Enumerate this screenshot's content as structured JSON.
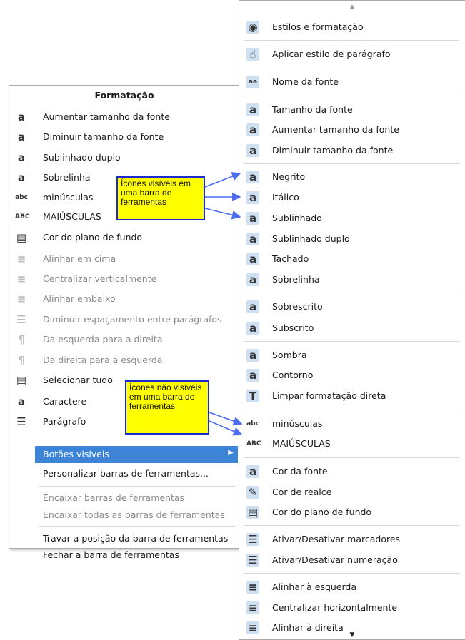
{
  "left_menu": {
    "title": "Formatação",
    "items": [
      {
        "icon": "increase-font-icon",
        "glyph": "a",
        "label": "Aumentar tamanho da fonte"
      },
      {
        "icon": "decrease-font-icon",
        "glyph": "a",
        "label": "Diminuir tamanho da fonte"
      },
      {
        "icon": "double-underline-icon",
        "glyph": "a",
        "label": "Sublinhado duplo"
      },
      {
        "icon": "overline-icon",
        "glyph": "a",
        "label": "Sobrelinha"
      },
      {
        "icon": "lowercase-icon",
        "glyph": "abc",
        "label": "minúsculas"
      },
      {
        "icon": "uppercase-icon",
        "glyph": "ABC",
        "label": "MAIÚSCULAS"
      },
      {
        "icon": "background-color-icon",
        "glyph": "▤",
        "label": "Cor do plano de fundo"
      },
      {
        "icon": "align-top-icon",
        "glyph": "≡",
        "label": "Alinhar em cima"
      },
      {
        "icon": "center-vertically-icon",
        "glyph": "≡",
        "label": "Centralizar verticalmente"
      },
      {
        "icon": "align-bottom-icon",
        "glyph": "≡",
        "label": "Alinhar embaixo"
      },
      {
        "icon": "decrease-paragraph-spacing-icon",
        "glyph": "☰",
        "label": "Diminuir espaçamento entre parágrafos"
      },
      {
        "icon": "left-to-right-icon",
        "glyph": "¶",
        "label": "Da esquerda para a direita"
      },
      {
        "icon": "right-to-left-icon",
        "glyph": "¶",
        "label": "Da direita para a esquerda"
      },
      {
        "icon": "select-all-icon",
        "glyph": "▤",
        "label": "Selecionar tudo"
      },
      {
        "icon": "character-icon",
        "glyph": "a",
        "label": "Caractere"
      },
      {
        "icon": "paragraph-icon",
        "glyph": "☰",
        "label": "Parágrafo"
      }
    ],
    "visible_buttons": "Botões visíveis",
    "customize": "Personalizar barras de ferramentas...",
    "dock": "Encaixar barras de ferramentas",
    "dock_all": "Encaixar todas as barras de ferramentas",
    "lock": "Travar a posição da barra de ferramentas",
    "close": "Fechar a barra de ferramentas"
  },
  "right_menu": {
    "items": [
      {
        "icon": "styles-icon",
        "glyph": "◉",
        "label": "Estilos e formatação"
      },
      {
        "icon": "apply-paragraph-style-icon",
        "glyph": "☝",
        "label": "Aplicar estilo de parágrafo"
      },
      {
        "icon": "font-name-icon",
        "glyph": "aa",
        "label": "Nome da fonte"
      },
      {
        "icon": "font-size-icon",
        "glyph": "a",
        "label": "Tamanho da fonte"
      },
      {
        "icon": "increase-font-icon",
        "glyph": "a",
        "label": "Aumentar tamanho da fonte"
      },
      {
        "icon": "decrease-font-icon",
        "glyph": "a",
        "label": "Diminuir tamanho da fonte"
      },
      {
        "icon": "bold-icon",
        "glyph": "a",
        "label": "Negrito"
      },
      {
        "icon": "italic-icon",
        "glyph": "a",
        "label": "Itálico"
      },
      {
        "icon": "underline-icon",
        "glyph": "a",
        "label": "Sublinhado"
      },
      {
        "icon": "double-underline-icon",
        "glyph": "a",
        "label": "Sublinhado duplo"
      },
      {
        "icon": "strikethrough-icon",
        "glyph": "a",
        "label": "Tachado"
      },
      {
        "icon": "overline-icon",
        "glyph": "a",
        "label": "Sobrelinha"
      },
      {
        "icon": "superscript-icon",
        "glyph": "a",
        "label": "Sobrescrito"
      },
      {
        "icon": "subscript-icon",
        "glyph": "a",
        "label": "Subscrito"
      },
      {
        "icon": "shadow-icon",
        "glyph": "a",
        "label": "Sombra"
      },
      {
        "icon": "outline-icon",
        "glyph": "a",
        "label": "Contorno"
      },
      {
        "icon": "clear-formatting-icon",
        "glyph": "T",
        "label": "Limpar formatação direta"
      },
      {
        "icon": "lowercase-icon",
        "glyph": "abc",
        "label": "minúsculas"
      },
      {
        "icon": "uppercase-icon",
        "glyph": "ABC",
        "label": "MAIÚSCULAS"
      },
      {
        "icon": "font-color-icon",
        "glyph": "a",
        "label": "Cor da fonte"
      },
      {
        "icon": "highlight-color-icon",
        "glyph": "✎",
        "label": "Cor de realce"
      },
      {
        "icon": "background-color-icon",
        "glyph": "▤",
        "label": "Cor do plano de fundo"
      },
      {
        "icon": "bullets-icon",
        "glyph": "☰",
        "label": "Ativar/Desativar marcadores"
      },
      {
        "icon": "numbering-icon",
        "glyph": "☰",
        "label": "Ativar/Desativar numeração"
      },
      {
        "icon": "align-left-icon",
        "glyph": "≡",
        "label": "Alinhar à esquerda"
      },
      {
        "icon": "center-horizontally-icon",
        "glyph": "≡",
        "label": "Centralizar horizontalmente"
      },
      {
        "icon": "align-right-icon",
        "glyph": "≡",
        "label": "Alinhar à direita"
      }
    ]
  },
  "callouts": {
    "visible": "Ícones visíveis em uma barra de ferramentas",
    "not_visible": "Ícones não visíveis em uma barra de ferramentas"
  },
  "colors": {
    "selection": "#3d84d6",
    "callout_bg": "#ffff00",
    "callout_border": "#1a2bd0",
    "icon_highlight": "#cfe0f2"
  }
}
